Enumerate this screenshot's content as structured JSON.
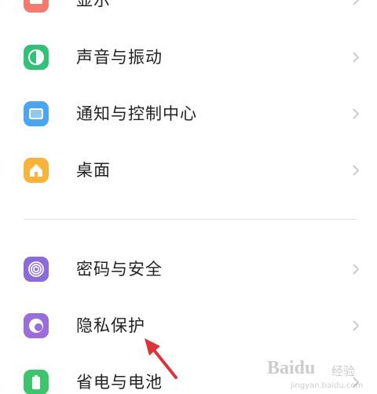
{
  "settings": {
    "items": [
      {
        "label": "显示",
        "icon": "display-icon",
        "color": "#f27a6e"
      },
      {
        "label": "声音与振动",
        "icon": "sound-icon",
        "color": "#33c079"
      },
      {
        "label": "通知与控制中心",
        "icon": "notification-icon",
        "color": "#4aa6f0"
      },
      {
        "label": "桌面",
        "icon": "home-icon",
        "color": "#f7b43c"
      },
      {
        "label": "密码与安全",
        "icon": "fingerprint-icon",
        "color": "#8a6bd8"
      },
      {
        "label": "隐私保护",
        "icon": "privacy-icon",
        "color": "#9a6ddb"
      },
      {
        "label": "省电与电池",
        "icon": "battery-icon",
        "color": "#3ec46a"
      }
    ]
  },
  "watermark": {
    "brand": "Baidu",
    "suffix": "经验",
    "url": "jingyan.baidu.com"
  },
  "annotation": {
    "arrow_color": "#d9343a"
  }
}
